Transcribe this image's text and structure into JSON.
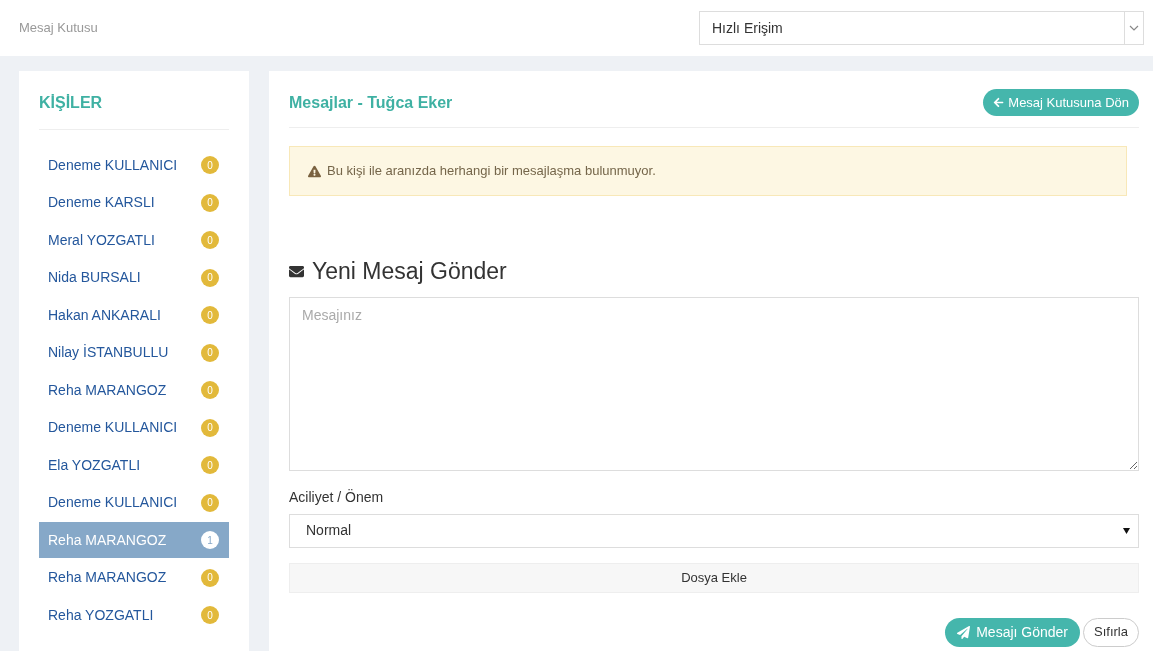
{
  "header": {
    "breadcrumb": "Mesaj Kutusu",
    "quick_access": {
      "value": "Hızlı Erişim"
    }
  },
  "contacts": {
    "title": "KİŞİLER",
    "items": [
      {
        "name": "Deneme KULLANICI",
        "count": "0",
        "selected": false
      },
      {
        "name": "Deneme KARSLI",
        "count": "0",
        "selected": false
      },
      {
        "name": "Meral YOZGATLI",
        "count": "0",
        "selected": false
      },
      {
        "name": "Nida BURSALI",
        "count": "0",
        "selected": false
      },
      {
        "name": "Hakan ANKARALI",
        "count": "0",
        "selected": false
      },
      {
        "name": "Nilay İSTANBULLU",
        "count": "0",
        "selected": false
      },
      {
        "name": "Reha MARANGOZ",
        "count": "0",
        "selected": false
      },
      {
        "name": "Deneme KULLANICI",
        "count": "0",
        "selected": false
      },
      {
        "name": "Ela YOZGATLI",
        "count": "0",
        "selected": false
      },
      {
        "name": "Deneme KULLANICI",
        "count": "0",
        "selected": false
      },
      {
        "name": "Reha MARANGOZ",
        "count": "1",
        "selected": true
      },
      {
        "name": "Reha MARANGOZ",
        "count": "0",
        "selected": false
      },
      {
        "name": "Reha YOZGATLI",
        "count": "0",
        "selected": false
      }
    ]
  },
  "messages": {
    "title": "Mesajlar - Tuğca Eker",
    "back_button": "Mesaj Kutusuna Dön",
    "alert": "Bu kişi ile aranızda herhangi bir mesajlaşma bulunmuyor.",
    "compose": {
      "title": "Yeni Mesaj Gönder",
      "message": {
        "placeholder": "Mesajınız"
      },
      "priority_label": "Aciliyet / Önem",
      "priority": {
        "value": "Normal"
      },
      "attach_button": "Dosya Ekle",
      "send_button": "Mesajı Gönder",
      "reset_button": "Sıfırla"
    }
  }
}
